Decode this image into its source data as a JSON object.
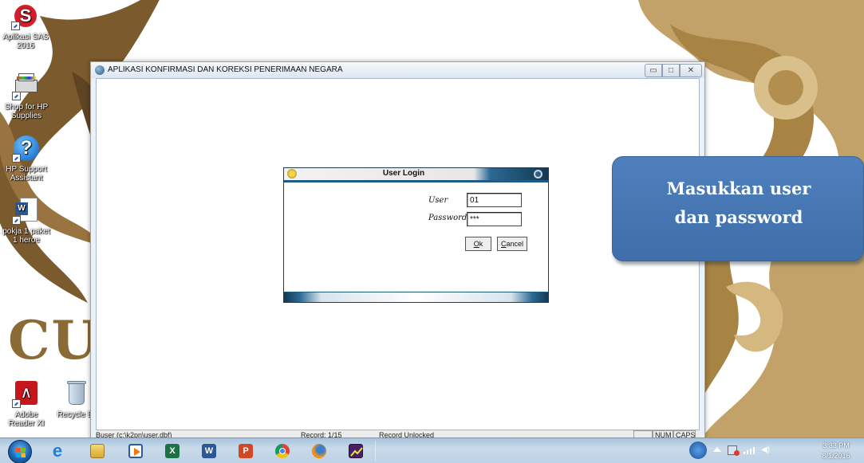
{
  "desktop": {
    "icons": [
      {
        "label": "Aplikasi SAS 2016",
        "icon": "sas-app-icon"
      },
      {
        "label": "Shop for HP Supplies",
        "icon": "printer-icon"
      },
      {
        "label": "HP Support Assistant",
        "icon": "help-icon"
      },
      {
        "label": "pokja 1 paket 1 heroe",
        "icon": "word-document-icon"
      },
      {
        "label": "Adobe Reader XI",
        "icon": "adobe-reader-icon"
      },
      {
        "label": "Recycle Bi",
        "icon": "recycle-bin-icon"
      }
    ],
    "wallpaper_letters": "CU"
  },
  "app_window": {
    "title": "APLIKASI KONFIRMASI DAN KOREKSI PENERIMAAN NEGARA",
    "controls": {
      "minimize": "▭",
      "maximize": "□",
      "close": "✕"
    }
  },
  "status_bar": {
    "path": "Buser (c:\\k2pn\\user.dbf)",
    "record": "Record: 1/15",
    "lock": "Record Unlocked",
    "num": "NUM",
    "caps": "CAPS"
  },
  "login": {
    "title": "User Login",
    "user_label": "User",
    "user_value": "01",
    "password_label": "Password",
    "password_value": "***",
    "ok_label_mnemonic": "O",
    "ok_label_rest": "k",
    "cancel_label_mnemonic": "C",
    "cancel_label_rest": "ancel"
  },
  "callout": {
    "line1": "Masukkan user",
    "line2": "dan password",
    "color": "#4f80bd"
  },
  "taskbar": {
    "pinned": [
      "start-orb",
      "internet-explorer-icon",
      "file-explorer-icon",
      "media-player-icon",
      "excel-icon",
      "word-icon",
      "powerpoint-icon",
      "chrome-icon",
      "firefox-icon",
      "chart-app-icon"
    ],
    "clock_time": "3:33 PM",
    "clock_date": "8/1/2016"
  }
}
